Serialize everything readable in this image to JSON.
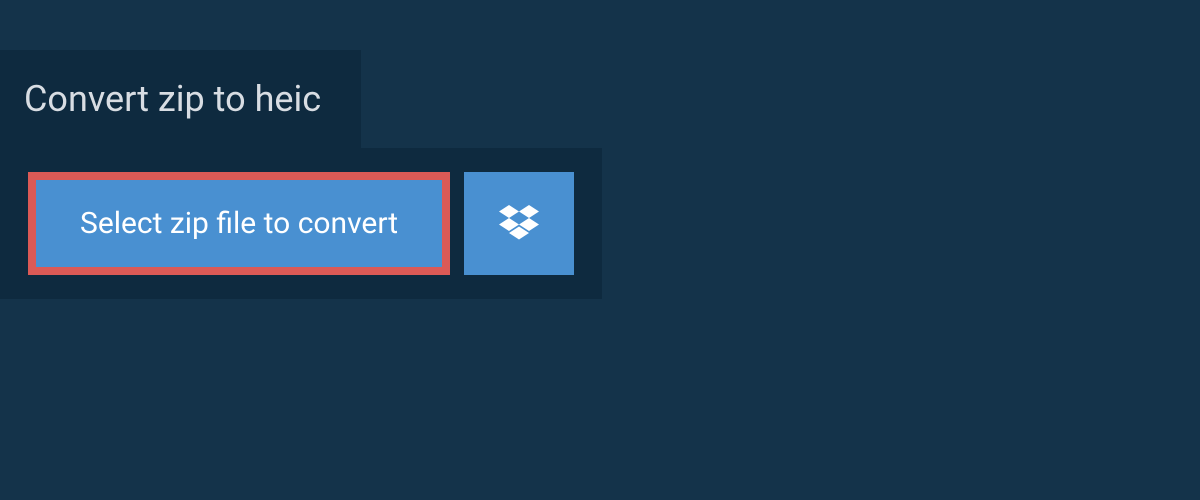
{
  "header": {
    "title": "Convert zip to heic"
  },
  "actions": {
    "select_file_label": "Select zip file to convert"
  },
  "colors": {
    "background": "#14334a",
    "panel": "#0e2a3f",
    "button": "#4990d1",
    "highlight_border": "#db5a56",
    "text_light": "#d8dde3",
    "text_white": "#ffffff"
  }
}
